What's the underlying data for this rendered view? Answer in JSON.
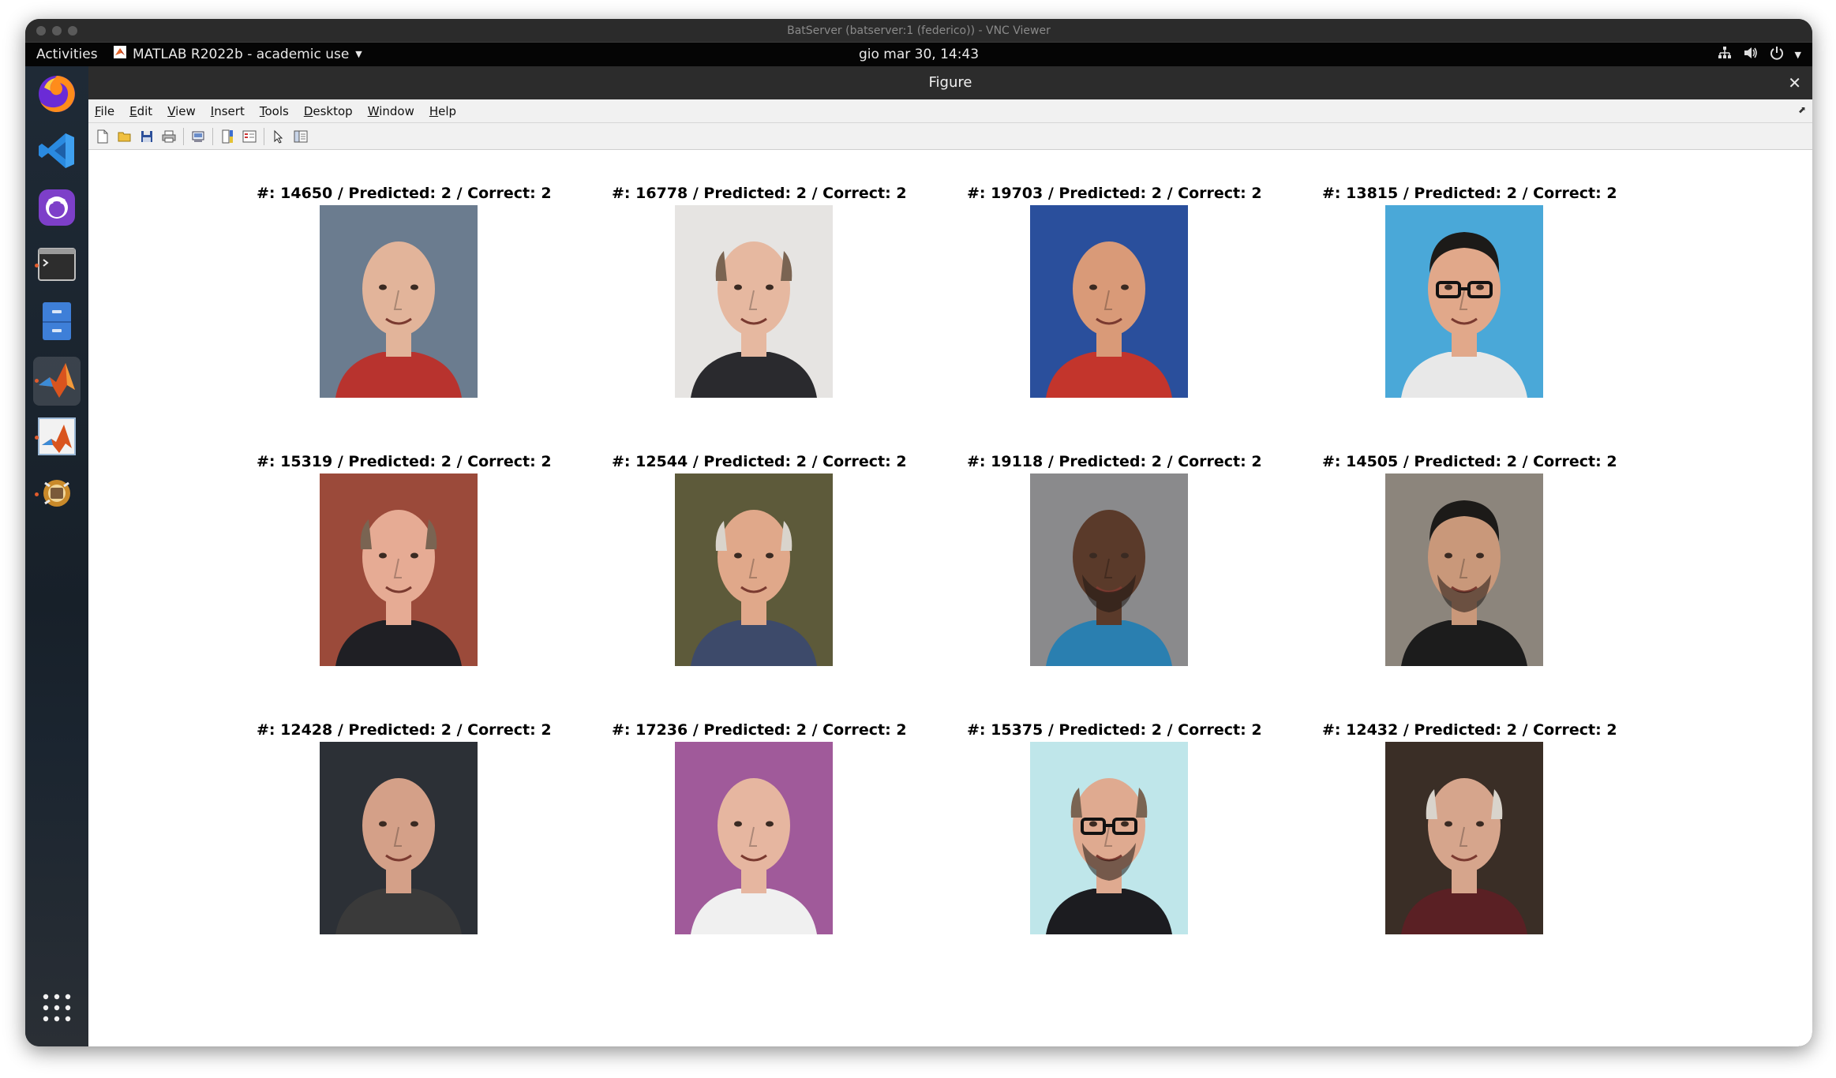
{
  "vnc": {
    "title": "BatServer (batserver:1 (federico)) - VNC Viewer"
  },
  "topbar": {
    "activities": "Activities",
    "app_name": "MATLAB R2022b - academic use",
    "clock": "gio mar 30, 14:43",
    "tray_icons": [
      "network-icon",
      "volume-icon",
      "power-icon",
      "dropdown-arrow-icon"
    ]
  },
  "dock": {
    "apps": [
      {
        "name": "firefox-icon",
        "running": false,
        "active": false
      },
      {
        "name": "vscode-icon",
        "running": false,
        "active": false
      },
      {
        "name": "github-desktop-icon",
        "running": false,
        "active": false
      },
      {
        "name": "terminal-icon",
        "running": true,
        "active": false
      },
      {
        "name": "file-cabinet-icon",
        "running": false,
        "active": false
      },
      {
        "name": "matlab-icon",
        "running": true,
        "active": true
      },
      {
        "name": "matlab-alt-icon",
        "running": true,
        "active": false
      },
      {
        "name": "package-icon",
        "running": true,
        "active": false
      },
      {
        "name": "app-grid-icon",
        "running": false,
        "active": false
      }
    ]
  },
  "figure": {
    "title": "Figure",
    "close_glyph": "✕",
    "menu": [
      "File",
      "Edit",
      "View",
      "Insert",
      "Tools",
      "Desktop",
      "Window",
      "Help"
    ],
    "toolbar_icons": [
      "new-figure-icon",
      "open-file-icon",
      "save-icon",
      "print-icon",
      "print-preview-icon",
      "colorbar-icon",
      "legend-icon",
      "pointer-icon",
      "property-inspector-icon"
    ],
    "panels": [
      {
        "label": "#: 14650 / Predicted: 2 / Correct: 2",
        "bg": "#6b7c8f",
        "skin": "#e2b49a",
        "shirt": "#b8332e",
        "hair": "none",
        "glasses": false,
        "beard": false
      },
      {
        "label": "#: 16778 / Predicted: 2 / Correct: 2",
        "bg": "#e6e4e2",
        "skin": "#e6b8a0",
        "shirt": "#2a2a2e",
        "hair": "sides",
        "glasses": false,
        "beard": false
      },
      {
        "label": "#: 19703 / Predicted: 2 / Correct: 2",
        "bg": "#2a4f9c",
        "skin": "#d99a78",
        "shirt": "#c3352c",
        "hair": "none",
        "glasses": false,
        "beard": false
      },
      {
        "label": "#: 13815 / Predicted: 2 / Correct: 2",
        "bg": "#4aa8d8",
        "skin": "#e1a88a",
        "shirt": "#e8e8e8",
        "hair": "dark",
        "glasses": true,
        "beard": false
      },
      {
        "label": "#: 15319 / Predicted: 2 / Correct: 2",
        "bg": "#9b4a3a",
        "skin": "#e6ab94",
        "shirt": "#1f1f24",
        "hair": "sides",
        "glasses": false,
        "beard": false
      },
      {
        "label": "#: 12544 / Predicted: 2 / Correct: 2",
        "bg": "#5d5a3a",
        "skin": "#e0a88a",
        "shirt": "#3d4a6a",
        "hair": "sides-white",
        "glasses": false,
        "beard": false
      },
      {
        "label": "#: 19118 / Predicted: 2 / Correct: 2",
        "bg": "#8a8a8c",
        "skin": "#5a3a2a",
        "shirt": "#2a7fb0",
        "hair": "none",
        "glasses": false,
        "beard": true
      },
      {
        "label": "#: 14505 / Predicted: 2 / Correct: 2",
        "bg": "#8c857c",
        "skin": "#c9987a",
        "shirt": "#1c1c1c",
        "hair": "dark",
        "glasses": false,
        "beard": true
      },
      {
        "label": "#: 12428 / Predicted: 2 / Correct: 2",
        "bg": "#2c3036",
        "skin": "#d4a088",
        "shirt": "#3a3a3a",
        "hair": "none",
        "glasses": false,
        "beard": false
      },
      {
        "label": "#: 17236 / Predicted: 2 / Correct: 2",
        "bg": "#a05a9a",
        "skin": "#e6b6a0",
        "shirt": "#f0f0f0",
        "hair": "none",
        "glasses": false,
        "beard": false
      },
      {
        "label": "#: 15375 / Predicted: 2 / Correct: 2",
        "bg": "#bfe6ea",
        "skin": "#dfaa90",
        "shirt": "#1c1c20",
        "hair": "sides",
        "glasses": true,
        "beard": true
      },
      {
        "label": "#: 12432 / Predicted: 2 / Correct: 2",
        "bg": "#3a2e26",
        "skin": "#d6a58c",
        "shirt": "#5a2024",
        "hair": "sides-white",
        "glasses": false,
        "beard": false
      }
    ]
  }
}
